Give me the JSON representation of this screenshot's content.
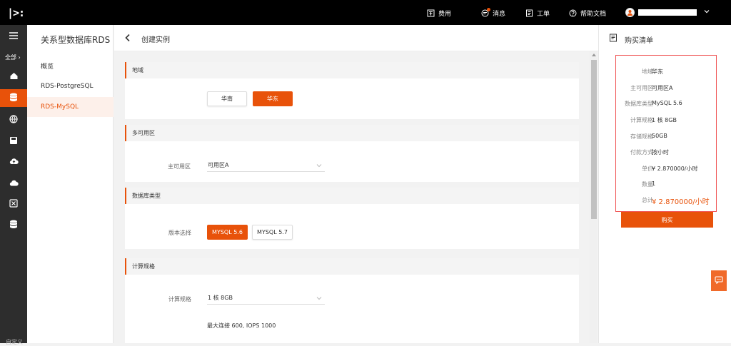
{
  "topbar": {
    "logo": "|>:",
    "billing": "费用",
    "messages": "消息",
    "tickets": "工单",
    "help": "帮助文档"
  },
  "rail": {
    "all_label": "全部",
    "custom_label": "自定义"
  },
  "subnav": {
    "title": "关系型数据库RDS",
    "items": [
      {
        "label": "概览"
      },
      {
        "label": "RDS-PostgreSQL"
      },
      {
        "label": "RDS-MySQL"
      }
    ]
  },
  "page": {
    "title": "创建实例"
  },
  "sections": {
    "region": {
      "title": "地域",
      "options": [
        "华南",
        "华东"
      ],
      "selected": "华东"
    },
    "az": {
      "title": "多可用区",
      "field_label": "主可用区",
      "value": "可用区A"
    },
    "db_type": {
      "title": "数据库类型",
      "field_label": "版本选择",
      "options": [
        "MYSQL 5.6",
        "MYSQL 5.7"
      ],
      "selected": "MYSQL 5.6"
    },
    "compute": {
      "title": "计算规格",
      "field_label": "计算规格",
      "value": "1 核 8GB",
      "note": "最大连接 600, IOPS 1000"
    }
  },
  "cart": {
    "title": "购买清单",
    "rows": [
      {
        "key": "地域",
        "value": "华东"
      },
      {
        "key": "主可用区",
        "value": "可用区A"
      },
      {
        "key": "数据库类型",
        "value": "MySQL 5.6"
      },
      {
        "key": "计算规格",
        "value": "1 核 8GB"
      },
      {
        "key": "存储规格",
        "value": "50GB"
      },
      {
        "key": "付款方式",
        "value": "按小时"
      },
      {
        "key": "单价",
        "value": "¥ 2.870000/小时"
      },
      {
        "key": "数量",
        "value": "1"
      },
      {
        "key": "总计",
        "value": "¥ 2.870000/小时"
      }
    ],
    "buy_label": "购买"
  },
  "colors": {
    "accent": "#e8520a",
    "topbar": "#000000",
    "rail": "#2d2d2d",
    "cart_border": "#f05454"
  }
}
